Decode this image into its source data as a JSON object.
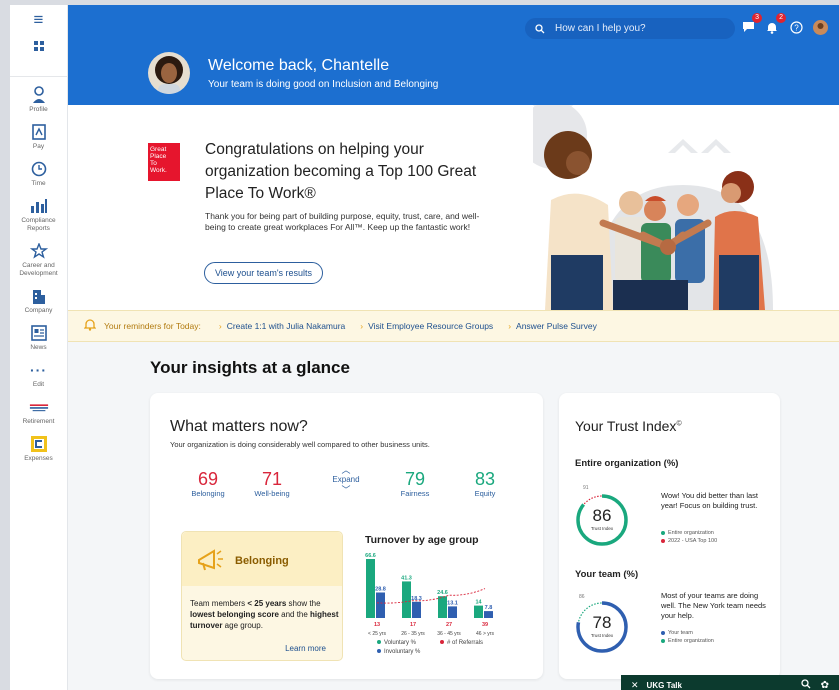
{
  "sidebar": {
    "items": [
      {
        "label": "Profile",
        "icon": "person-icon"
      },
      {
        "label": "Pay",
        "icon": "pay-icon"
      },
      {
        "label": "Time",
        "icon": "clock-icon"
      },
      {
        "label": "Compliance Reports",
        "icon": "reports-icon"
      },
      {
        "label": "Career and Development",
        "icon": "career-icon"
      },
      {
        "label": "Company",
        "icon": "building-icon"
      },
      {
        "label": "News",
        "icon": "news-icon"
      },
      {
        "label": "Edit",
        "icon": "more-icon"
      },
      {
        "label": "Retirement",
        "icon": "empower-logo"
      },
      {
        "label": "Expenses",
        "icon": "expenses-icon"
      }
    ]
  },
  "header": {
    "search_placeholder": "How can I help you?",
    "chat_badge": "3",
    "notif_badge": "2"
  },
  "hero": {
    "welcome": "Welcome back, Chantelle",
    "subtitle": "Your team is doing good on Inclusion and Belonging"
  },
  "banner": {
    "logo_lines": [
      "Great",
      "Place",
      "To",
      "Work."
    ],
    "headline": "Congratulations on helping your organization becoming a Top 100 Great Place To Work®",
    "body": "Thank you for being part of building purpose, equity, trust, care, and well-being to create great workplaces For All™. Keep up the fantastic work!",
    "button": "View your team's results"
  },
  "reminders": {
    "title": "Your reminders for Today:",
    "items": [
      "Create 1:1 with  Julia Nakamura",
      "Visit Employee Resource Groups",
      "Answer Pulse Survey"
    ]
  },
  "insights_title": "Your insights at a glance",
  "matters": {
    "title": "What matters now?",
    "subtitle": "Your organization is doing considerably well compared to other business units.",
    "metrics": [
      {
        "value": "69",
        "label": "Belonging",
        "color": "#d9263b"
      },
      {
        "value": "71",
        "label": "Well-being",
        "color": "#d9263b"
      },
      {
        "value": "79",
        "label": "Fairness",
        "color": "#1aa87e"
      },
      {
        "value": "83",
        "label": "Equity",
        "color": "#1aa87e"
      }
    ],
    "expand": "Expand",
    "belonging": {
      "title": "Belonging",
      "text_pre": "Team members ",
      "text_b1": "< 25 years",
      "text_mid1": " show the ",
      "text_b2": "lowest belonging score",
      "text_mid2": " and the ",
      "text_b3": "highest turnover",
      "text_post": " age group.",
      "learn_more": "Learn more"
    }
  },
  "chart_data": {
    "type": "bar",
    "title": "Turnover by age group",
    "categories": [
      "< 25 yrs",
      "26 - 35 yrs",
      "36 - 45 yrs",
      "46 > yrs"
    ],
    "series": [
      {
        "name": "Voluntary %",
        "color": "#1aa87e",
        "values": [
          66.6,
          41.3,
          24.6,
          14
        ]
      },
      {
        "name": "Involuntary %",
        "color": "#2f5fb0",
        "values": [
          28.8,
          18.3,
          13.1,
          7.8
        ]
      }
    ],
    "referrals": {
      "name": "# of Referrals",
      "color": "#d9263b",
      "values": [
        13,
        17,
        27,
        39
      ]
    },
    "ylim": [
      0,
      70
    ]
  },
  "trust": {
    "title": "Your Trust Index",
    "sup": "©",
    "org_title": "Entire organization (%)",
    "org_value": "86",
    "org_value_num": 86,
    "org_prev": "91",
    "org_label": "Trust Index",
    "org_desc": "Wow! You did better than last year! Focus on building trust.",
    "org_leg1": "Entire organization",
    "org_leg2": "2022 - USA Top 100",
    "team_title": "Your team (%)",
    "team_value": "78",
    "team_value_num": 78,
    "team_prev": "86",
    "team_label": "Trust Index",
    "team_desc": "Most of your teams are doing well. The New York team needs your help.",
    "team_leg1": "Your team",
    "team_leg2": "Entire organization"
  },
  "talk": {
    "title": "UKG Talk"
  }
}
